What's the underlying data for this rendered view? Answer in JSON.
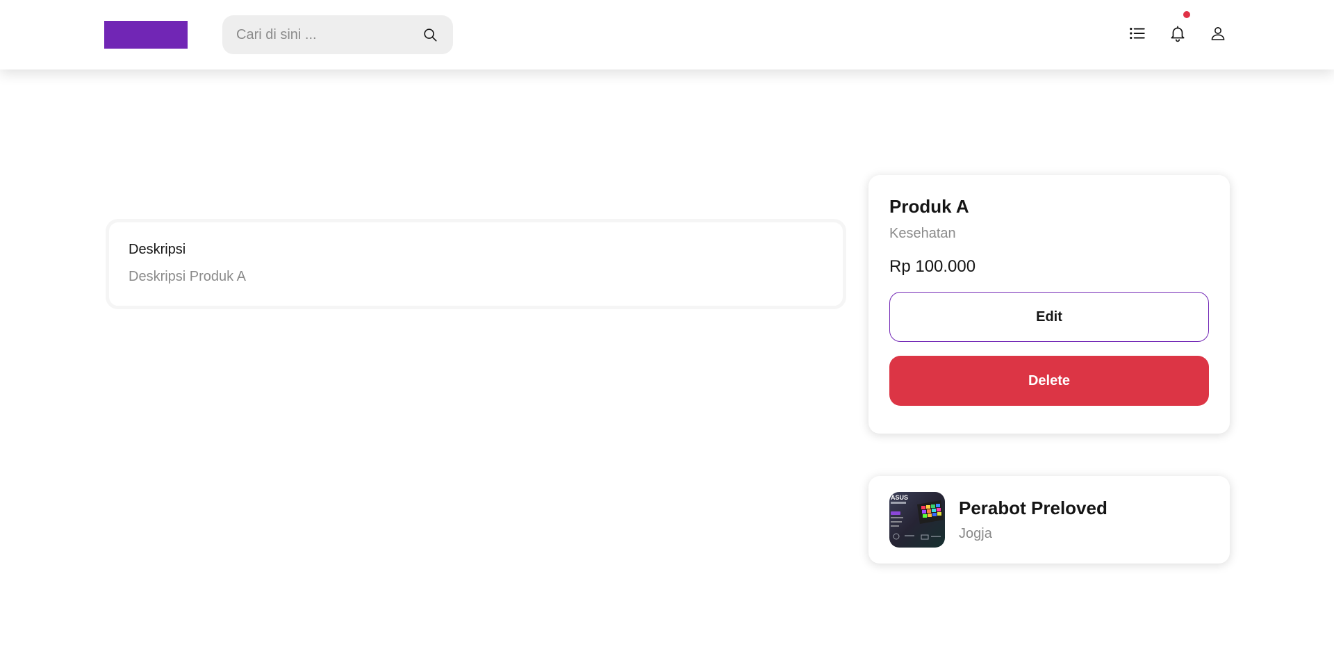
{
  "header": {
    "search": {
      "placeholder": "Cari di sini ...",
      "value": ""
    },
    "icons": [
      "search-icon",
      "list-icon",
      "bell-icon",
      "user-icon"
    ],
    "notification_dot": true
  },
  "description": {
    "title": "Deskripsi",
    "text": "Deskripsi Produk A"
  },
  "product": {
    "name": "Produk A",
    "category": "Kesehatan",
    "price": "Rp 100.000",
    "edit_label": "Edit",
    "delete_label": "Delete"
  },
  "seller": {
    "name": "Perabot Preloved",
    "city": "Jogja",
    "avatar_text": "ASUS"
  },
  "colors": {
    "brand": "#7126b5",
    "danger": "#dc3545",
    "notification": "#e03146",
    "muted_text": "#8a8a8a"
  }
}
